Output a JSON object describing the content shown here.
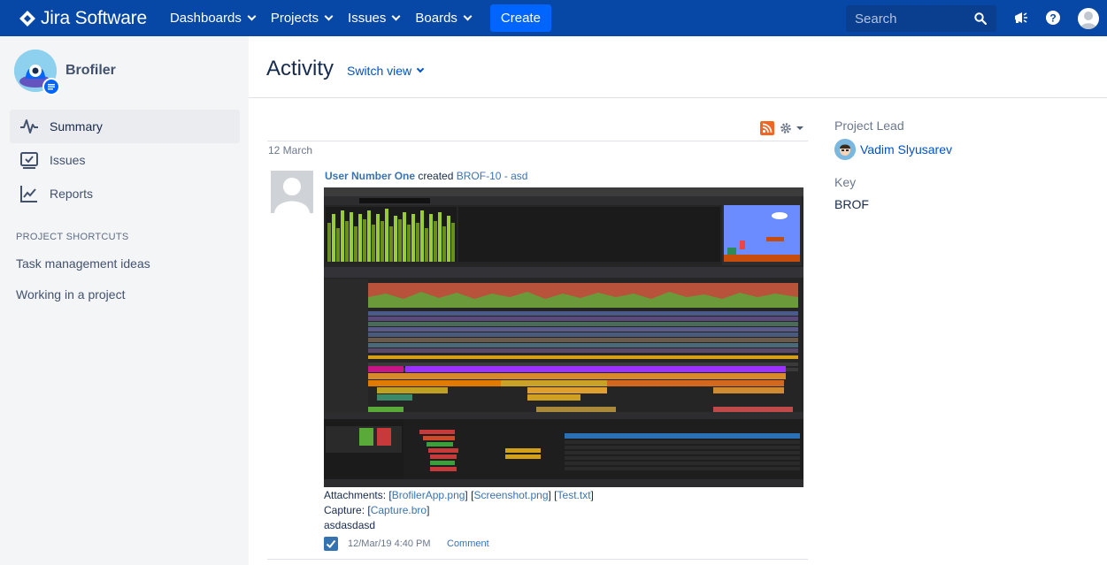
{
  "topnav": {
    "app_name": "Jira Software",
    "items": [
      {
        "label": "Dashboards"
      },
      {
        "label": "Projects"
      },
      {
        "label": "Issues"
      },
      {
        "label": "Boards"
      }
    ],
    "create_label": "Create",
    "search_placeholder": "Search",
    "brand_color": "#0747a6"
  },
  "sidebar": {
    "project_name": "Brofiler",
    "items": [
      {
        "label": "Summary",
        "icon": "activity-icon",
        "active": true
      },
      {
        "label": "Issues",
        "icon": "issues-icon"
      },
      {
        "label": "Reports",
        "icon": "reports-icon"
      }
    ],
    "shortcuts_heading": "PROJECT SHORTCUTS",
    "shortcuts": [
      "Task management ideas",
      "Working in a project"
    ]
  },
  "main": {
    "title": "Activity",
    "switch_view": "Switch view",
    "date_heading": "12 March",
    "activity": {
      "user": "User Number One",
      "verb": "created",
      "issue": "BROF-10 - asd",
      "attachments_label": "Attachments:",
      "attachments": [
        "BrofilerApp.png",
        "Screenshot.png",
        "Test.txt"
      ],
      "capture_label": "Capture:",
      "capture_file": "Capture.bro",
      "description": "asdasdasd",
      "timestamp": "12/Mar/19 4:40 PM",
      "comment_label": "Comment"
    }
  },
  "right_panel": {
    "lead_label": "Project Lead",
    "lead_name": "Vadim Slyusarev",
    "key_label": "Key",
    "key_value": "BROF"
  }
}
